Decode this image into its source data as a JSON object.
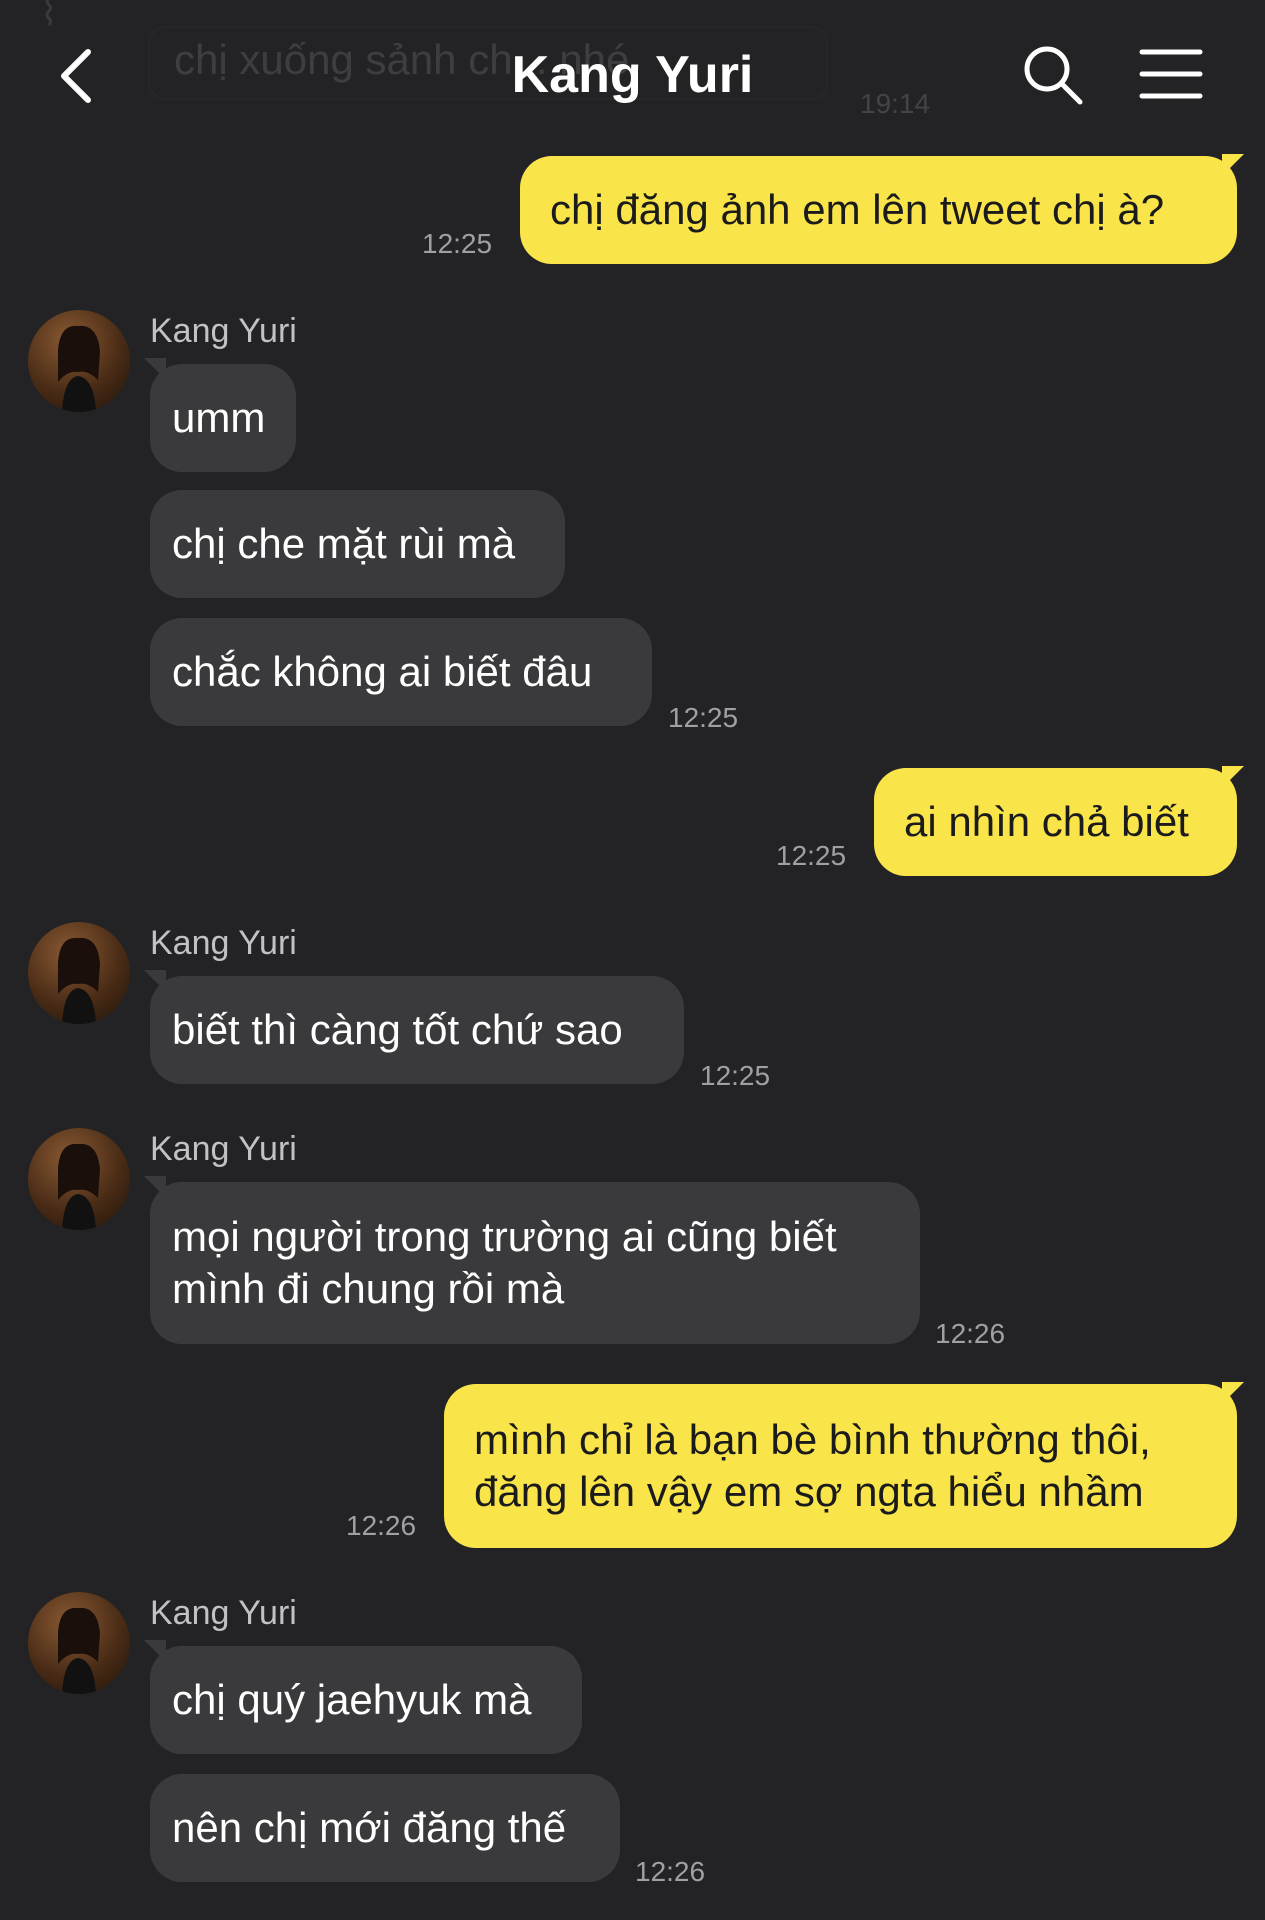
{
  "header": {
    "title": "Kang Yuri"
  },
  "previous_message": {
    "text": "chị xuống sảnh ch... nhé",
    "time": "19:14"
  },
  "messages": [
    {
      "text": "chị đăng ảnh em lên tweet chị à?",
      "time": "12:25"
    },
    {
      "sender": "Kang Yuri"
    },
    {
      "text": "umm"
    },
    {
      "text": "chị che mặt rùi mà"
    },
    {
      "text": "chắc không ai biết đâu",
      "time": "12:25"
    },
    {
      "text": "ai nhìn chả biết",
      "time": "12:25"
    },
    {
      "sender": "Kang Yuri",
      "text": "biết thì càng tốt chứ sao",
      "time": "12:25"
    },
    {
      "sender": "Kang Yuri",
      "text": "mọi người trong trường ai cũng biết\nmình đi chung rồi mà",
      "time": "12:26"
    },
    {
      "text": "mình chỉ là bạn bè bình thường thôi,\nđăng lên vậy em sợ ngta hiểu nhầm",
      "time": "12:26"
    },
    {
      "sender": "Kang Yuri",
      "text": "chị quý jaehyuk mà"
    },
    {
      "text": "nên chị mới đăng thế",
      "time": "12:26"
    }
  ],
  "colors": {
    "background": "#232325",
    "outgoing_bubble": "#f9e44a",
    "incoming_bubble": "#3a3a3c"
  },
  "icons": [
    "back-arrow-icon",
    "search-icon",
    "menu-icon",
    "avatar-image"
  ]
}
